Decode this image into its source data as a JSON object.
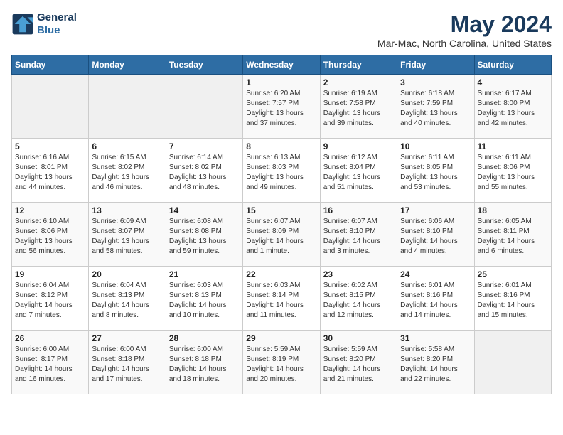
{
  "header": {
    "logo_line1": "General",
    "logo_line2": "Blue",
    "month": "May 2024",
    "location": "Mar-Mac, North Carolina, United States"
  },
  "weekdays": [
    "Sunday",
    "Monday",
    "Tuesday",
    "Wednesday",
    "Thursday",
    "Friday",
    "Saturday"
  ],
  "weeks": [
    [
      {
        "day": "",
        "text": ""
      },
      {
        "day": "",
        "text": ""
      },
      {
        "day": "",
        "text": ""
      },
      {
        "day": "1",
        "text": "Sunrise: 6:20 AM\nSunset: 7:57 PM\nDaylight: 13 hours and 37 minutes."
      },
      {
        "day": "2",
        "text": "Sunrise: 6:19 AM\nSunset: 7:58 PM\nDaylight: 13 hours and 39 minutes."
      },
      {
        "day": "3",
        "text": "Sunrise: 6:18 AM\nSunset: 7:59 PM\nDaylight: 13 hours and 40 minutes."
      },
      {
        "day": "4",
        "text": "Sunrise: 6:17 AM\nSunset: 8:00 PM\nDaylight: 13 hours and 42 minutes."
      }
    ],
    [
      {
        "day": "5",
        "text": "Sunrise: 6:16 AM\nSunset: 8:01 PM\nDaylight: 13 hours and 44 minutes."
      },
      {
        "day": "6",
        "text": "Sunrise: 6:15 AM\nSunset: 8:02 PM\nDaylight: 13 hours and 46 minutes."
      },
      {
        "day": "7",
        "text": "Sunrise: 6:14 AM\nSunset: 8:02 PM\nDaylight: 13 hours and 48 minutes."
      },
      {
        "day": "8",
        "text": "Sunrise: 6:13 AM\nSunset: 8:03 PM\nDaylight: 13 hours and 49 minutes."
      },
      {
        "day": "9",
        "text": "Sunrise: 6:12 AM\nSunset: 8:04 PM\nDaylight: 13 hours and 51 minutes."
      },
      {
        "day": "10",
        "text": "Sunrise: 6:11 AM\nSunset: 8:05 PM\nDaylight: 13 hours and 53 minutes."
      },
      {
        "day": "11",
        "text": "Sunrise: 6:11 AM\nSunset: 8:06 PM\nDaylight: 13 hours and 55 minutes."
      }
    ],
    [
      {
        "day": "12",
        "text": "Sunrise: 6:10 AM\nSunset: 8:06 PM\nDaylight: 13 hours and 56 minutes."
      },
      {
        "day": "13",
        "text": "Sunrise: 6:09 AM\nSunset: 8:07 PM\nDaylight: 13 hours and 58 minutes."
      },
      {
        "day": "14",
        "text": "Sunrise: 6:08 AM\nSunset: 8:08 PM\nDaylight: 13 hours and 59 minutes."
      },
      {
        "day": "15",
        "text": "Sunrise: 6:07 AM\nSunset: 8:09 PM\nDaylight: 14 hours and 1 minute."
      },
      {
        "day": "16",
        "text": "Sunrise: 6:07 AM\nSunset: 8:10 PM\nDaylight: 14 hours and 3 minutes."
      },
      {
        "day": "17",
        "text": "Sunrise: 6:06 AM\nSunset: 8:10 PM\nDaylight: 14 hours and 4 minutes."
      },
      {
        "day": "18",
        "text": "Sunrise: 6:05 AM\nSunset: 8:11 PM\nDaylight: 14 hours and 6 minutes."
      }
    ],
    [
      {
        "day": "19",
        "text": "Sunrise: 6:04 AM\nSunset: 8:12 PM\nDaylight: 14 hours and 7 minutes."
      },
      {
        "day": "20",
        "text": "Sunrise: 6:04 AM\nSunset: 8:13 PM\nDaylight: 14 hours and 8 minutes."
      },
      {
        "day": "21",
        "text": "Sunrise: 6:03 AM\nSunset: 8:13 PM\nDaylight: 14 hours and 10 minutes."
      },
      {
        "day": "22",
        "text": "Sunrise: 6:03 AM\nSunset: 8:14 PM\nDaylight: 14 hours and 11 minutes."
      },
      {
        "day": "23",
        "text": "Sunrise: 6:02 AM\nSunset: 8:15 PM\nDaylight: 14 hours and 12 minutes."
      },
      {
        "day": "24",
        "text": "Sunrise: 6:01 AM\nSunset: 8:16 PM\nDaylight: 14 hours and 14 minutes."
      },
      {
        "day": "25",
        "text": "Sunrise: 6:01 AM\nSunset: 8:16 PM\nDaylight: 14 hours and 15 minutes."
      }
    ],
    [
      {
        "day": "26",
        "text": "Sunrise: 6:00 AM\nSunset: 8:17 PM\nDaylight: 14 hours and 16 minutes."
      },
      {
        "day": "27",
        "text": "Sunrise: 6:00 AM\nSunset: 8:18 PM\nDaylight: 14 hours and 17 minutes."
      },
      {
        "day": "28",
        "text": "Sunrise: 6:00 AM\nSunset: 8:18 PM\nDaylight: 14 hours and 18 minutes."
      },
      {
        "day": "29",
        "text": "Sunrise: 5:59 AM\nSunset: 8:19 PM\nDaylight: 14 hours and 20 minutes."
      },
      {
        "day": "30",
        "text": "Sunrise: 5:59 AM\nSunset: 8:20 PM\nDaylight: 14 hours and 21 minutes."
      },
      {
        "day": "31",
        "text": "Sunrise: 5:58 AM\nSunset: 8:20 PM\nDaylight: 14 hours and 22 minutes."
      },
      {
        "day": "",
        "text": ""
      }
    ]
  ]
}
